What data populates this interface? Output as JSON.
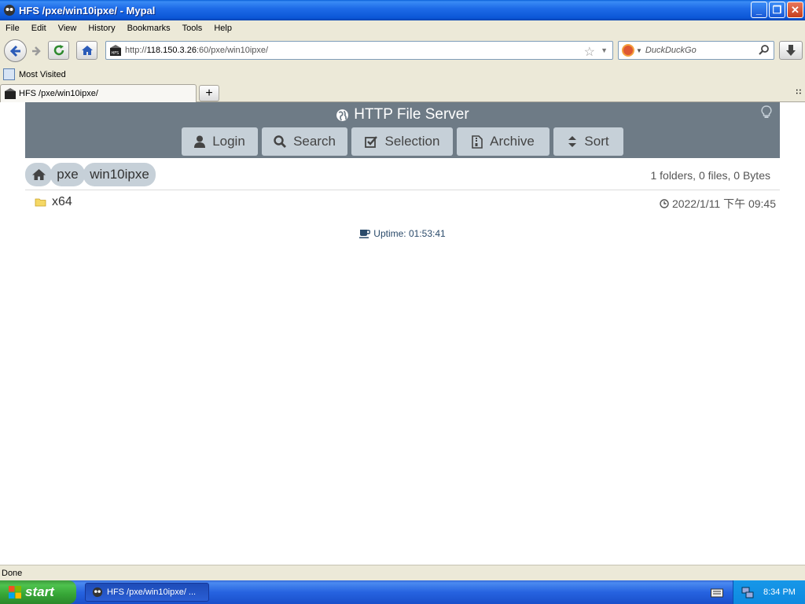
{
  "window": {
    "title": "HFS /pxe/win10ipxe/ - Mypal",
    "controls": [
      "minimize",
      "maximize",
      "close"
    ]
  },
  "menu": [
    "File",
    "Edit",
    "View",
    "History",
    "Bookmarks",
    "Tools",
    "Help"
  ],
  "toolbar": {
    "url_scheme": "http://",
    "url_host": "118.150.3.26",
    "url_rest": ":60/pxe/win10ipxe/",
    "search_placeholder": "DuckDuckGo"
  },
  "bookmarks": {
    "most_visited": "Most Visited"
  },
  "tabs": [
    {
      "label": "HFS /pxe/win10ipxe/",
      "active": true
    }
  ],
  "hfs": {
    "title": "HTTP File Server",
    "buttons": [
      {
        "label": "Login",
        "icon": "user-icon"
      },
      {
        "label": "Search",
        "icon": "search-icon"
      },
      {
        "label": "Selection",
        "icon": "checkbox-icon"
      },
      {
        "label": "Archive",
        "icon": "archive-icon"
      },
      {
        "label": "Sort",
        "icon": "sort-icon"
      }
    ],
    "breadcrumb": [
      {
        "label": "",
        "icon": "home-icon"
      },
      {
        "label": "pxe"
      },
      {
        "label": "win10ipxe"
      }
    ],
    "summary": "1 folders, 0 files, 0 Bytes",
    "files": [
      {
        "name": "x64",
        "type": "folder",
        "date": "2022/1/11 下午 09:45"
      }
    ],
    "uptime": "Uptime: 01:53:41"
  },
  "status": {
    "text": "Done"
  },
  "taskbar": {
    "start": "start",
    "task_label": "HFS /pxe/win10ipxe/ ...",
    "clock": "8:34 PM"
  },
  "colors": {
    "hfs_header": "#6e7b86",
    "hfs_button": "#c6d0d8",
    "xp_blue": "#2663e0",
    "start_green": "#36a536"
  }
}
